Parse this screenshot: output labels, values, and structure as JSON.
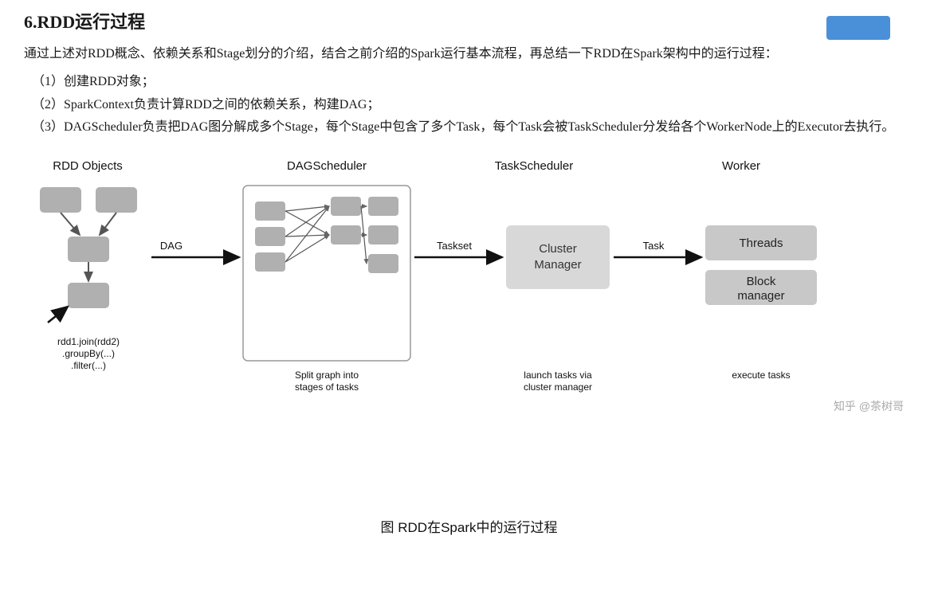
{
  "page": {
    "title": "6.RDD运行过程",
    "intro": [
      "通过上述对RDD概念、依赖关系和Stage划分的介绍，结合之前介绍的Spark运行基本流程，再总结一下RDD在Spark架构中的运行过程：",
      "（1）创建RDD对象；",
      "（2）SparkContext负责计算RDD之间的依赖关系，构建DAG；",
      "（3）DAGScheduler负责把DAG图分解成多个Stage，每个Stage中包含了多个Task，每个Task会被TaskScheduler分发给各个WorkerNode上的Executor去执行。"
    ],
    "diagram": {
      "caption": "图 RDD在Spark中的运行过程",
      "columns": {
        "rdd_objects": {
          "label": "RDD Objects",
          "caption": "rdd1.join(rdd2)\n.groupBy(...)\n.filter(...)"
        },
        "dag_scheduler": {
          "label": "DAGScheduler",
          "caption": "Split graph into\nstages of tasks",
          "arrow_label": "DAG"
        },
        "task_scheduler": {
          "label": "TaskScheduler",
          "caption": "launch tasks via\ncluster manager",
          "arrow_label": "Taskset",
          "cluster_text": "Cluster\nManager"
        },
        "worker": {
          "label": "Worker",
          "caption": "execute tasks",
          "arrow_label": "Task",
          "threads_label": "Threads",
          "block_manager_label": "Block\nmanager"
        }
      }
    },
    "watermark": "知乎 @茶树哥"
  }
}
